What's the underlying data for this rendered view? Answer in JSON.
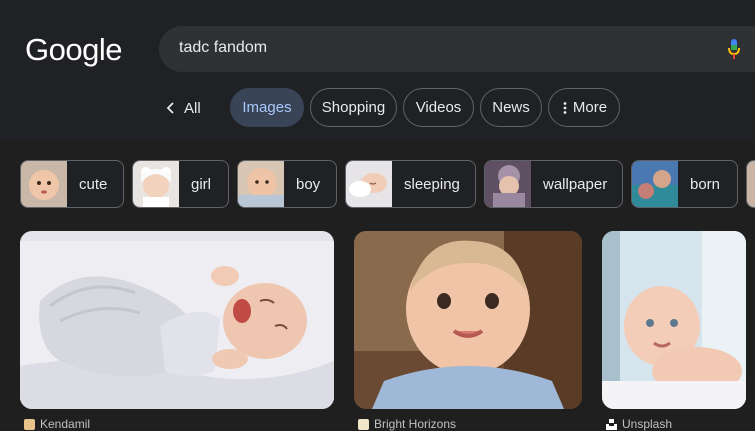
{
  "header": {
    "logo_text": "Google",
    "search": {
      "value": "tadc fandom"
    }
  },
  "tabs": {
    "back_label": "All",
    "items": [
      {
        "label": "Images",
        "active": true
      },
      {
        "label": "Shopping"
      },
      {
        "label": "Videos"
      },
      {
        "label": "News"
      },
      {
        "label": "More"
      }
    ],
    "more_icon": "vertical-dots-icon"
  },
  "chips": [
    {
      "label": "cute"
    },
    {
      "label": "girl"
    },
    {
      "label": "boy"
    },
    {
      "label": "sleeping"
    },
    {
      "label": "wallpaper"
    },
    {
      "label": "born"
    }
  ],
  "results": [
    {
      "source": "Kendamil"
    },
    {
      "source": "Bright Horizons"
    },
    {
      "source": "Unsplash"
    }
  ],
  "colors": {
    "background": "#1f1f1f",
    "search_bg": "#303134",
    "active_tab_bg": "#394457",
    "active_tab_text": "#a8c7fa"
  }
}
